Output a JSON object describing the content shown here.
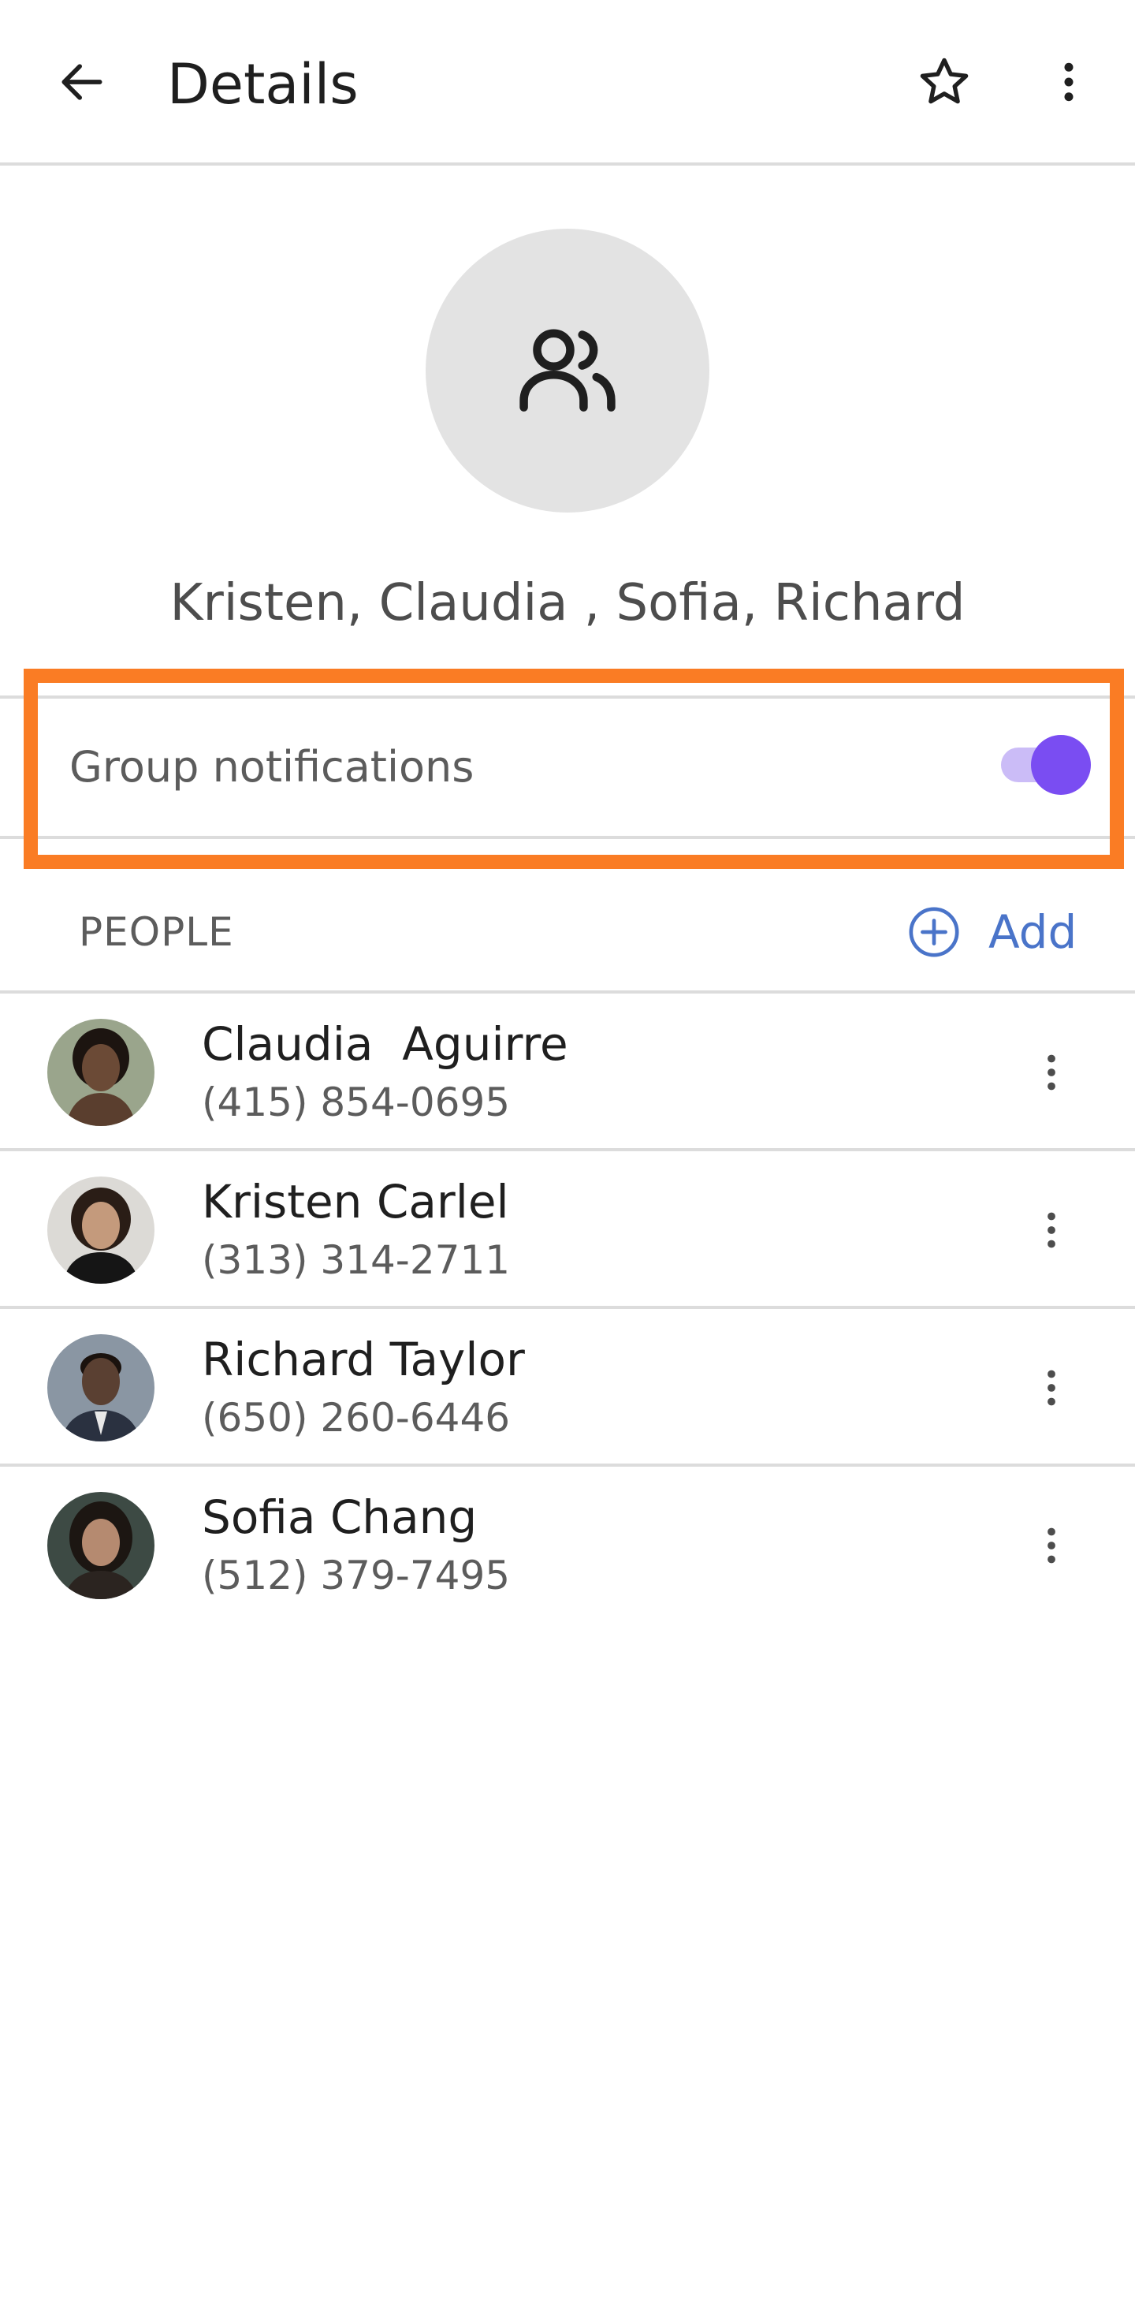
{
  "app_bar": {
    "title": "Details",
    "back_icon": "arrow-left-icon",
    "star_icon": "star-outline-icon",
    "more_icon": "more-vertical-icon"
  },
  "group": {
    "avatar_icon": "group-people-icon",
    "name": "Kristen, Claudia , Sofia, Richard"
  },
  "notifications": {
    "label": "Group notifications",
    "enabled": true,
    "accent_color": "#7a4df2"
  },
  "highlight": {
    "color": "#fa7c24"
  },
  "people": {
    "header": "PEOPLE",
    "add_label": "Add",
    "add_icon": "plus-circle-icon",
    "contacts": [
      {
        "name": "Claudia  Aguirre",
        "phone": "(415) 854-0695",
        "avatar_color": "#6b4a36"
      },
      {
        "name": "Kristen Carlel",
        "phone": "(313) 314-2711",
        "avatar_color": "#8a6a52"
      },
      {
        "name": "Richard Taylor",
        "phone": "(650) 260-6446",
        "avatar_color": "#4b3a30"
      },
      {
        "name": "Sofia Chang",
        "phone": "(512) 379-7495",
        "avatar_color": "#7a5644"
      }
    ]
  }
}
